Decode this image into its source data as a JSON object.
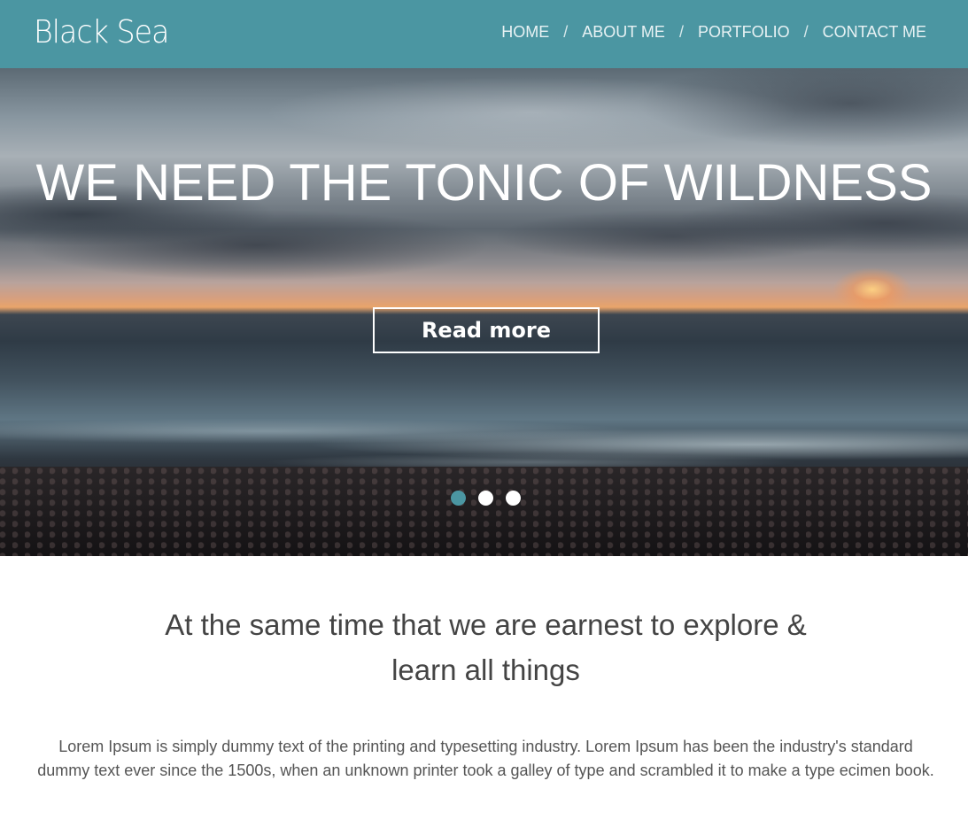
{
  "header": {
    "logo": "Black Sea",
    "nav": [
      {
        "label": "HOME"
      },
      {
        "label": "ABOUT ME"
      },
      {
        "label": "PORTFOLIO"
      },
      {
        "label": "CONTACT ME"
      }
    ],
    "separator": "/"
  },
  "hero": {
    "title": "WE NEED THE TONIC OF WILDNESS",
    "button_label": "Read more",
    "slides": 3,
    "active_slide": 1
  },
  "content": {
    "tagline_line1": "At the same time that we are earnest to explore &",
    "tagline_line2": "learn all things",
    "body": "Lorem Ipsum is simply dummy text of the printing and typesetting industry. Lorem Ipsum has been the industry's standard dummy text ever since the 1500s, when an unknown printer took a galley of type and scrambled it to make a type ecimen book."
  },
  "colors": {
    "accent": "#4b96a2",
    "text": "#444444"
  }
}
